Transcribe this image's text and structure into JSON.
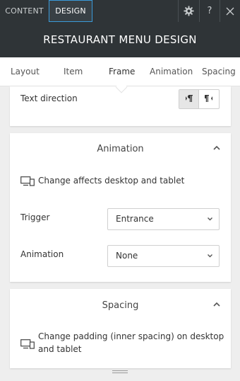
{
  "topbar": {
    "tabs": [
      {
        "label": "CONTENT"
      },
      {
        "label": "DESIGN"
      }
    ],
    "icons": [
      "gear-icon",
      "help-icon",
      "close-icon"
    ],
    "help_glyph": "?"
  },
  "header": {
    "title": "RESTAURANT MENU DESIGN"
  },
  "nav": {
    "tabs": [
      {
        "label": "Layout"
      },
      {
        "label": "Item"
      },
      {
        "label": "Frame"
      },
      {
        "label": "Animation"
      },
      {
        "label": "Spacing"
      }
    ],
    "active": "Frame"
  },
  "frame": {
    "text_direction_label": "Text direction",
    "direction_options": [
      "ltr-icon",
      "rtl-icon"
    ],
    "selected_direction": "ltr-icon"
  },
  "animation_section": {
    "title": "Animation",
    "device_note": "Change affects desktop and tablet",
    "trigger_label": "Trigger",
    "trigger_value": "Entrance",
    "animation_label": "Animation",
    "animation_value": "None"
  },
  "spacing_section": {
    "title": "Spacing",
    "device_note": "Change padding (inner spacing) on desktop and tablet"
  },
  "colors": {
    "dark_bar": "#2f3437",
    "accent": "#3a9ad9",
    "panel_bg": "#eeeeee",
    "card_bg": "#ffffff"
  }
}
